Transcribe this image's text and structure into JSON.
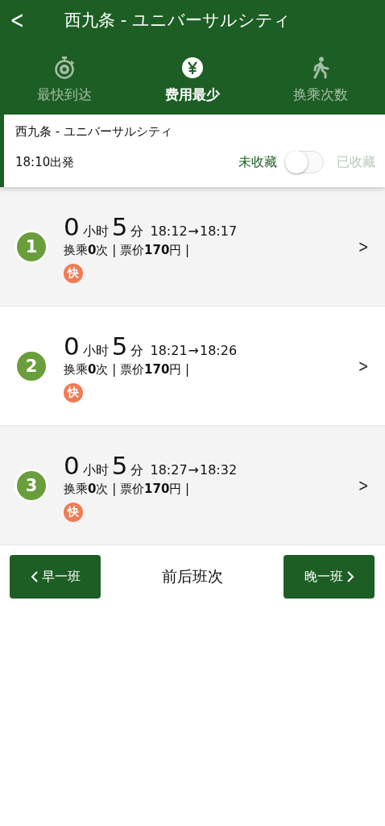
{
  "header": {
    "back": "<",
    "title": "西九条 - ユニバーサルシティ"
  },
  "tabs": [
    {
      "label": "最快到达",
      "kind": "stopwatch",
      "selected": false
    },
    {
      "label": "费用最少",
      "kind": "yen",
      "selected": true
    },
    {
      "label": "换乘次数",
      "kind": "walk",
      "selected": false
    }
  ],
  "summary": {
    "route": "西九条 - ユニバーサルシティ",
    "departure": "18:10出発",
    "off_label": "未收藏",
    "on_label": "已收藏",
    "favorited": false
  },
  "routes": [
    {
      "number": "1",
      "hours": "0",
      "hours_unit": "小时",
      "minutes": "5",
      "minutes_unit": "分",
      "depart": "18:12",
      "arrow": "→",
      "arrive": "18:17",
      "details": "换乘**0**次 | 票价**170**円 |",
      "badge": "快",
      "chevron": ">"
    },
    {
      "number": "2",
      "hours": "0",
      "hours_unit": "小时",
      "minutes": "5",
      "minutes_unit": "分",
      "depart": "18:21",
      "arrow": "→",
      "arrive": "18:26",
      "details": "换乘**0**次 | 票价**170**円 |",
      "badge": "快",
      "chevron": ">"
    },
    {
      "number": "3",
      "hours": "0",
      "hours_unit": "小时",
      "minutes": "5",
      "minutes_unit": "分",
      "depart": "18:27",
      "arrow": "→",
      "arrive": "18:32",
      "details": "换乘**0**次 | 票价**170**円 |",
      "badge": "快",
      "chevron": ">"
    }
  ],
  "pager": {
    "earlier": "早一班",
    "label": "前后班次",
    "later": "晚一班"
  }
}
